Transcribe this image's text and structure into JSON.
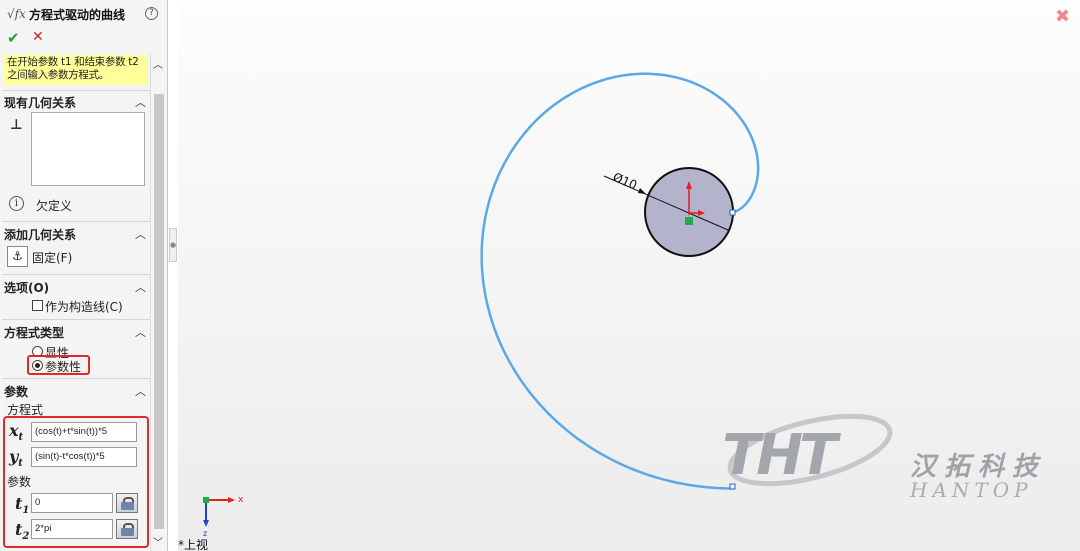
{
  "panel": {
    "title": "方程式驱动的曲线",
    "title_icon": "fx-curve-icon",
    "help_glyph": "?",
    "ok_glyph": "✔",
    "cancel_glyph": "✕",
    "message": "在开始参数 t1 和结束参数 t2 之间输入参数方程式。"
  },
  "sections": {
    "existing_relations": {
      "title": "现有几何关系",
      "status": "欠定义"
    },
    "add_relations": {
      "title": "添加几何关系",
      "fix_label": "固定(F)"
    },
    "options": {
      "title": "选项(O)",
      "construction_label": "作为构造线(C)",
      "construction_checked": false
    },
    "equation_type": {
      "title": "方程式类型",
      "explicit_label": "显性",
      "parametric_label": "参数性",
      "selected": "参数性"
    },
    "parameters": {
      "title": "参数",
      "equations_label": "方程式",
      "xt_var": "x",
      "xt_sub": "t",
      "xt_value": "(cos(t)+t*sin(t))*5",
      "yt_var": "y",
      "yt_sub": "t",
      "yt_value": "(sin(t)-t*cos(t))*5",
      "params_label": "参数",
      "t1_var": "t",
      "t1_sub": "1",
      "t1_value": "0",
      "t2_var": "t",
      "t2_sub": "2",
      "t2_value": "2*pi"
    }
  },
  "viewport": {
    "dimension_label": "Ø10",
    "view_name": "*上视",
    "axis_x": "x",
    "axis_z": "z",
    "close_glyph": "✖",
    "colors": {
      "curve": "#5ba8e8",
      "circle_fill": "#b3b3cc",
      "highlight": "#e02a2a",
      "origin_red": "#e02222",
      "origin_green": "#22aa44"
    }
  },
  "watermark": {
    "logo_text": "THT",
    "name_zh": "汉拓科技",
    "name_en": "HANTOP"
  }
}
